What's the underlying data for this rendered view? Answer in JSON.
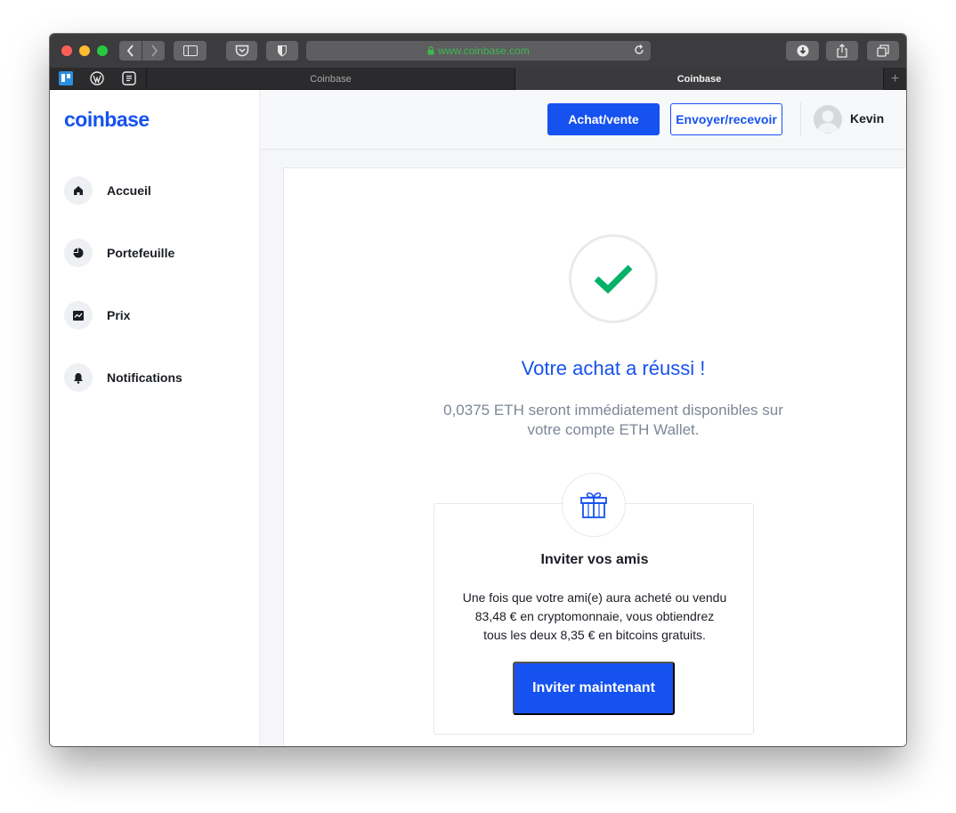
{
  "browser": {
    "url": "www.coinbase.com",
    "tabs": [
      {
        "label": "Coinbase",
        "active": false
      },
      {
        "label": "Coinbase",
        "active": true
      }
    ],
    "colors": {
      "url_text": "#3fb950",
      "chrome": "#3c3b3d"
    }
  },
  "sidebar": {
    "logo": "coinbase",
    "items": [
      {
        "label": "Accueil",
        "icon": "home-icon"
      },
      {
        "label": "Portefeuille",
        "icon": "pie-chart-icon"
      },
      {
        "label": "Prix",
        "icon": "chart-icon"
      },
      {
        "label": "Notifications",
        "icon": "bell-icon"
      }
    ]
  },
  "header": {
    "buy_sell_label": "Achat/vente",
    "send_receive_label": "Envoyer/recevoir",
    "user_name": "Kevin"
  },
  "main": {
    "success_title": "Votre achat a réussi !",
    "success_line1": "0,0375 ETH seront immédiatement disponibles sur",
    "success_line2": "votre compte ETH Wallet.",
    "invite": {
      "title": "Inviter vos amis",
      "line1": "Une fois que votre ami(e) aura acheté ou vendu",
      "line2": "83,48 € en cryptomonnaie, vous obtiendrez",
      "line3": "tous les deux 8,35 € en bitcoins gratuits.",
      "button_label": "Inviter maintenant"
    }
  },
  "colors": {
    "brand": "#1652f0",
    "success": "#05b169"
  }
}
